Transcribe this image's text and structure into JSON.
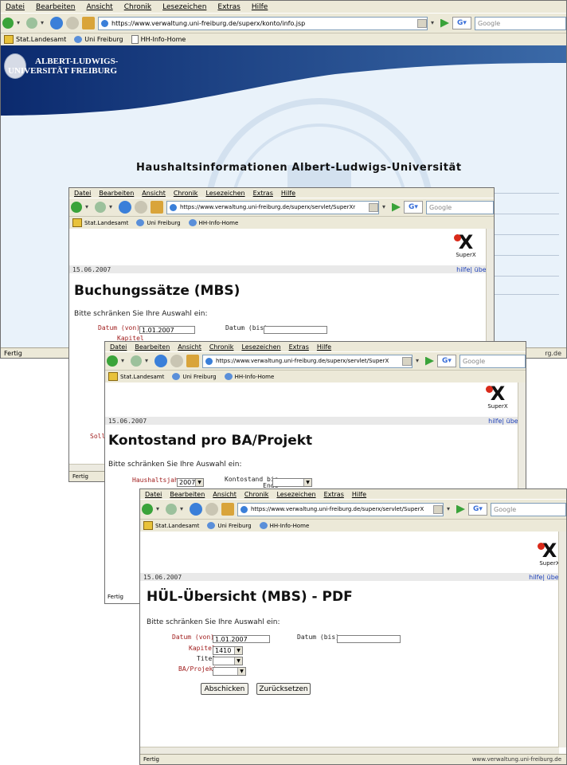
{
  "menu": [
    "Datei",
    "Bearbeiten",
    "Ansicht",
    "Chronik",
    "Lesezeichen",
    "Extras",
    "Hilfe"
  ],
  "search_placeholder": "Google",
  "bookmarks": [
    "Stat.Landesamt",
    "Uni Freiburg",
    "HH-Info-Home"
  ],
  "status": {
    "done": "Fertig",
    "host": "www.verwaltung.uni-freiburg.de"
  },
  "superx": "SuperX",
  "win1": {
    "url": "https://www.verwaltung.uni-freiburg.de/superx/konto/info.jsp",
    "uni_line1": "ALBERT-LUDWIGS-",
    "uni_line2": "UNIVERSITÄT FREIBURG",
    "heading": "Haushaltsinformationen Albert-Ludwigs-Universität",
    "status_host": "rg.de"
  },
  "win2": {
    "url": "https://www.verwaltung.uni-freiburg.de/superx/servlet/SuperXr",
    "date": "15.06.2007",
    "links": "hilfe| über",
    "title": "Buchungssätze (MBS)",
    "prompt": "Bitte schränken Sie Ihre Auswahl ein:",
    "datum_von_label": "Datum (von)",
    "datum_von_value": "1.01.2007",
    "datum_bis_label": "Datum (bis)",
    "kapitel_label": "Kapitel",
    "sollb_label": "Sollb"
  },
  "win3": {
    "url": "https://www.verwaltung.uni-freiburg.de/superx/servlet/SuperX",
    "date": "15.06.2007",
    "links": "hilfe| über",
    "title": "Kontostand pro BA/Projekt",
    "prompt": "Bitte schränken Sie Ihre Auswahl ein:",
    "haushaltsjahr_label": "Haushaltsjahr",
    "haushaltsjahr_value": "2007",
    "kontostand_label": "Kontostand bis",
    "kontostand_label2": "Ende"
  },
  "win4": {
    "url": "https://www.verwaltung.uni-freiburg.de/superx/servlet/SuperX",
    "date": "15.06.2007",
    "links": "hilfe| über",
    "title": "HÜL-Übersicht (MBS) - PDF",
    "prompt": "Bitte schränken Sie Ihre Auswahl ein:",
    "datum_von_label": "Datum (von)",
    "datum_von_value": "1.01.2007",
    "datum_bis_label": "Datum (bis)",
    "kapitel_label": "Kapitel",
    "kapitel_value": "1410",
    "titel_label": "Titel",
    "ba_label": "BA/Projekt",
    "submit": "Abschicken",
    "reset": "Zurücksetzen"
  }
}
